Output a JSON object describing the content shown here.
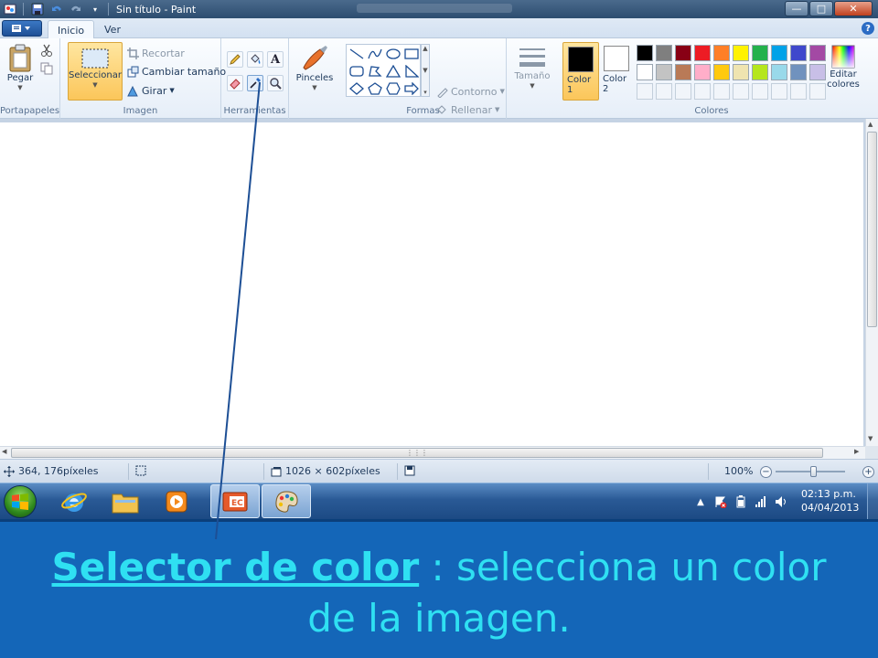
{
  "window": {
    "title": "Sin título - Paint",
    "buttons": {
      "minimize": "—",
      "maximize": "□",
      "close": "✕"
    }
  },
  "ribbon_tabs": [
    {
      "label": "Inicio",
      "active": true
    },
    {
      "label": "Ver",
      "active": false
    }
  ],
  "ribbon": {
    "clipboard": {
      "group_label": "Portapapeles",
      "paste_label": "Pegar"
    },
    "image": {
      "group_label": "Imagen",
      "select_label": "Seleccionar",
      "crop_label": "Recortar",
      "resize_label": "Cambiar tamaño",
      "rotate_label": "Girar"
    },
    "tools": {
      "group_label": "Herramientas",
      "items": [
        "pencil",
        "fill",
        "text",
        "eraser",
        "color-picker",
        "magnifier"
      ]
    },
    "brushes": {
      "label": "Pinceles"
    },
    "shapes": {
      "group_label": "Formas",
      "outline_label": "Contorno",
      "fill_label": "Rellenar"
    },
    "size": {
      "label": "Tamaño"
    },
    "colors": {
      "group_label": "Colores",
      "color1_label": "Color 1",
      "color2_label": "Color 2",
      "color1_value": "#000000",
      "color2_value": "#ffffff",
      "edit_label": "Editar colores",
      "palette": [
        "#000000",
        "#7f7f7f",
        "#880015",
        "#ed1c24",
        "#ff7f27",
        "#fff200",
        "#22b14c",
        "#00a2e8",
        "#3f48cc",
        "#a349a4",
        "#ffffff",
        "#c3c3c3",
        "#b97a57",
        "#ffaec9",
        "#ffc90e",
        "#efe4b0",
        "#b5e61d",
        "#99d9ea",
        "#7092be",
        "#c8bfe7"
      ]
    }
  },
  "status": {
    "cursor_position": "364, 176píxeles",
    "canvas_size": "1026 × 602píxeles",
    "zoom": "100%"
  },
  "taskbar": {
    "time": "02:13 p.m.",
    "date": "04/04/2013"
  },
  "caption": {
    "term": "Selector de color",
    "separator": " : ",
    "description": "selecciona un color de la imagen."
  }
}
